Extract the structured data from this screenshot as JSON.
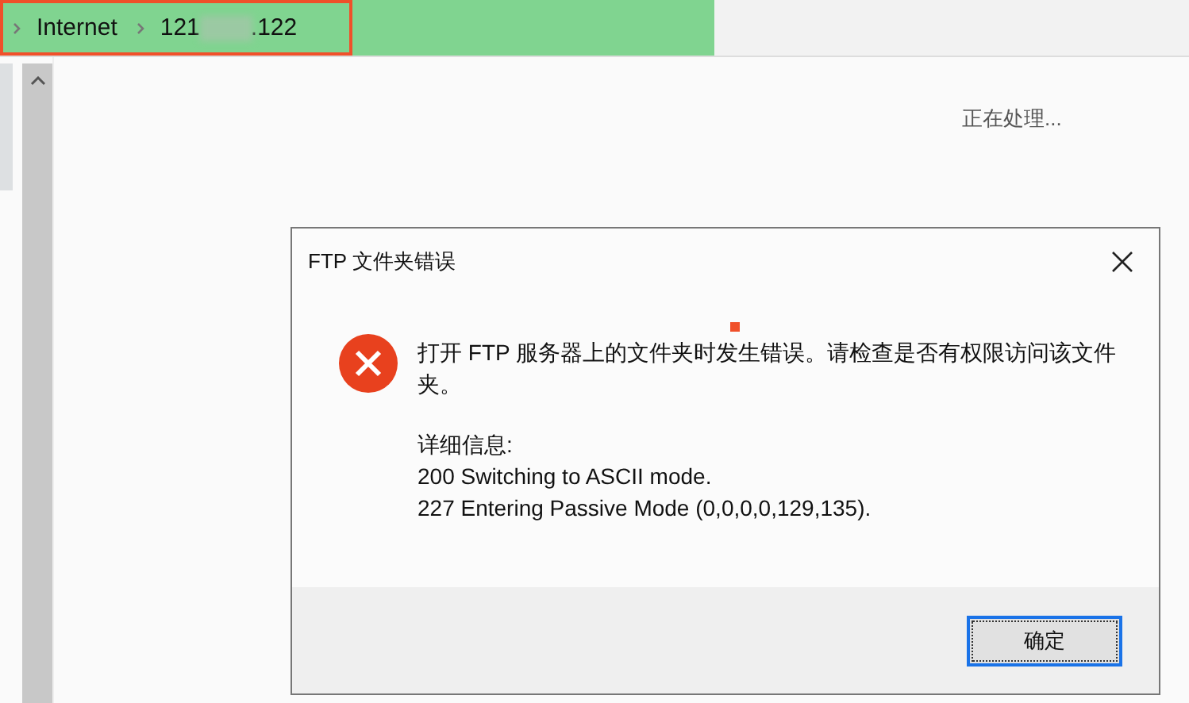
{
  "address_bar": {
    "segments": [
      {
        "kind": "plain",
        "text": "Internet"
      },
      {
        "kind": "redacted",
        "head": "121",
        "tail": ".122"
      }
    ],
    "highlighted": true
  },
  "status": "正在处理...",
  "dialog": {
    "title": "FTP 文件夹错误",
    "message": "打开 FTP 服务器上的文件夹时发生错误。请检查是否有权限访问该文件夹。",
    "details_label": "详细信息:",
    "details": [
      "200 Switching to ASCII mode.",
      "227 Entering Passive Mode (0,0,0,0,129,135)."
    ],
    "buttons": [
      {
        "label": "确定",
        "selected": true
      }
    ]
  }
}
